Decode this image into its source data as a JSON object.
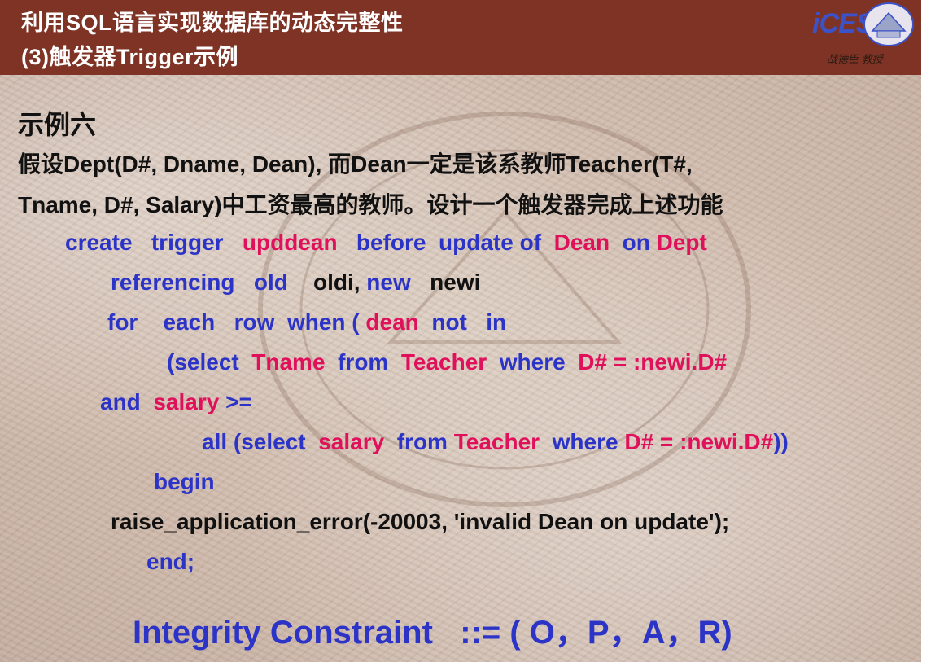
{
  "header": {
    "title_line1": "利用SQL语言实现数据库的动态完整性",
    "title_line2": "(3)触发器Trigger示例",
    "logo_text": "iCES",
    "logo_caption": "战德臣 教授"
  },
  "content": {
    "heading": "示例六",
    "desc_line1": "假设Dept(D#, Dname, Dean), 而Dean一定是该系教师Teacher(T#,",
    "desc_line2": "Tname, D#, Salary)中工资最高的教师。设计一个触发器完成上述功能",
    "code": {
      "l1": [
        "create",
        "trigger",
        "upddean",
        "before",
        "update of",
        "Dean",
        "on",
        "Dept"
      ],
      "l2": [
        "referencing",
        "old",
        "oldi,",
        "new",
        "newi"
      ],
      "l3": [
        "for",
        "each",
        "row",
        "when (",
        "dean",
        "not",
        "in"
      ],
      "l4": [
        "(select",
        "Tname",
        "from",
        "Teacher",
        "where",
        "D# = :newi.D#"
      ],
      "l5": [
        "and",
        "salary",
        ">="
      ],
      "l6": [
        "all (select",
        "salary",
        "from",
        "Teacher",
        "where",
        "D# = :newi.D#",
        "))"
      ],
      "l7": [
        "begin"
      ],
      "l8": [
        "raise_application_error(-20003, 'invalid Dean on update');"
      ],
      "l9": [
        "end;"
      ]
    },
    "formula": "Integrity Constraint   ::= ( O，P，A，R)"
  },
  "colors": {
    "header_bg": "#7f3325",
    "keyword_blue": "#2c34c8",
    "identifier_pink": "#e0105a",
    "text_black": "#111111"
  }
}
